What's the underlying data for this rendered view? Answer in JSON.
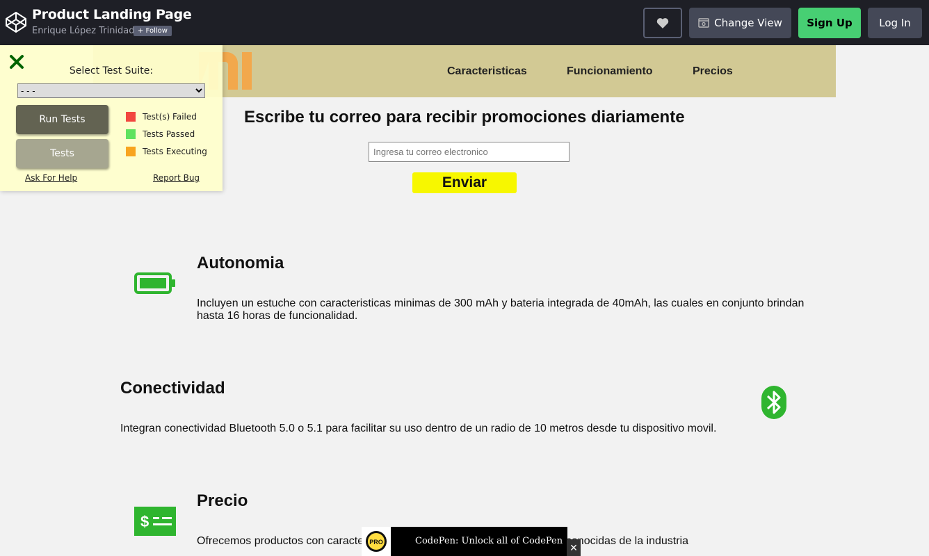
{
  "codepen": {
    "title": "Product Landing Page",
    "author": "Enrique López Trinidad",
    "follow_label": "+ Follow",
    "change_view_label": "Change View",
    "sign_up_label": "Sign Up",
    "log_in_label": "Log In"
  },
  "nav": {
    "links": [
      "Caracteristicas",
      "Funcionamiento",
      "Precios"
    ]
  },
  "promo": {
    "title": "Escribe tu correo para recibir promociones diariamente",
    "email_placeholder": "Ingresa tu correo electronico",
    "submit_label": "Enviar"
  },
  "features": [
    {
      "title": "Autonomia",
      "text": "Incluyen un estuche con caracteristicas minimas de 300 mAh y bateria integrada de 40mAh, las cuales en conjunto brindan hasta 16 horas de funcionalidad.",
      "icon": "battery-full-icon"
    },
    {
      "title": "Conectividad",
      "text": "Integran conectividad Bluetooth 5.0 o 5.1 para facilitar su uso dentro de un radio de 10 metros desde tu dispositivo movil.",
      "icon": "bluetooth-icon"
    },
    {
      "title": "Precio",
      "text": "Ofrecemos productos con caracte ios que compiten con las marcas mas reconocidas de la industria",
      "icon": "money-bill-icon"
    }
  ],
  "test_suite": {
    "label": "Select Test Suite:",
    "selected_option": "- - -",
    "run_label": "Run Tests",
    "tests_label": "Tests",
    "legend": [
      {
        "label": "Test(s) Failed",
        "color": "#f2473f"
      },
      {
        "label": "Tests Passed",
        "color": "#5fe25f"
      },
      {
        "label": "Tests Executing",
        "color": "#f8a41f"
      }
    ],
    "help_label": "Ask For Help",
    "bug_label": "Report Bug"
  },
  "pro_banner": {
    "badge": "PRO",
    "text": "CodePen: Unlock all of CodePen",
    "close": "✕"
  },
  "colors": {
    "accent_green": "#2fb52f",
    "nav_bg": "#d2c994",
    "mi_orange": "#ff6700",
    "cta_yellow": "#f7f700"
  }
}
